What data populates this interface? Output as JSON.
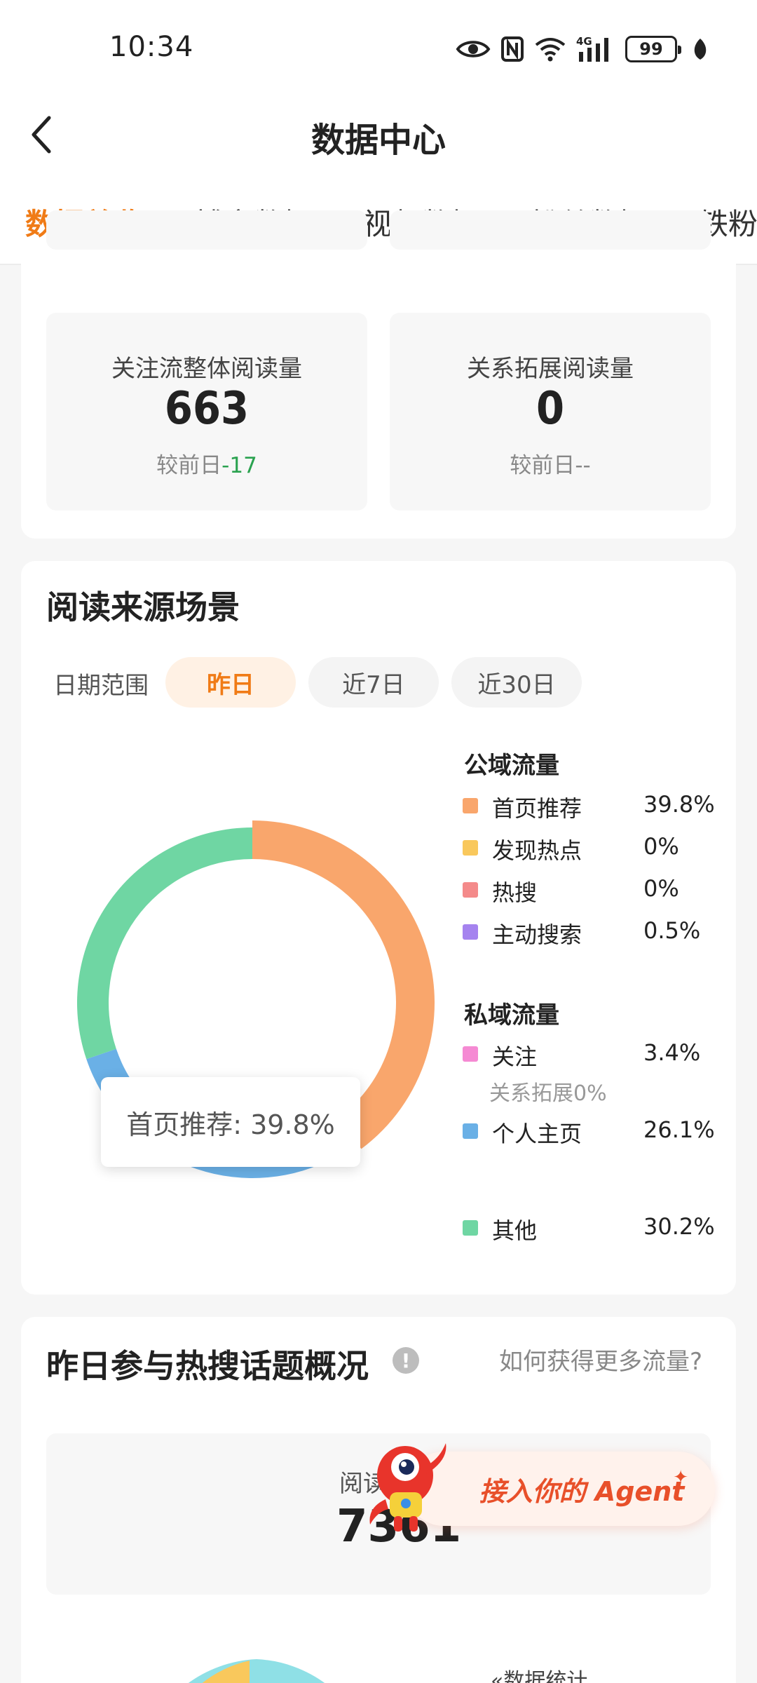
{
  "status_bar": {
    "time": "10:34",
    "battery": "99",
    "icons": [
      "eye-icon",
      "nfc-icon",
      "wifi-icon",
      "signal-4g-icon",
      "battery-icon",
      "leaf-icon"
    ]
  },
  "header": {
    "title": "数据中心"
  },
  "tabs": [
    {
      "label": "数据总览",
      "active": true
    },
    {
      "label": "博文数据",
      "active": false
    },
    {
      "label": "视频数据",
      "active": false
    },
    {
      "label": "粉丝数据",
      "active": false
    },
    {
      "label": "铁粉",
      "active": false
    }
  ],
  "stats": [
    {
      "label": "关注流整体阅读量",
      "value": "663",
      "compare_prefix": "较前日",
      "compare_value": "-17"
    },
    {
      "label": "关系拓展阅读量",
      "value": "0",
      "compare_prefix": "较前日",
      "compare_value": "--"
    }
  ],
  "read_source": {
    "title": "阅读来源场景",
    "date_range_label": "日期范围",
    "date_options": [
      {
        "label": "昨日",
        "active": true
      },
      {
        "label": "近7日",
        "active": false
      },
      {
        "label": "近30日",
        "active": false
      }
    ],
    "tooltip": "首页推荐: 39.8%",
    "groups": {
      "public": "公域流量",
      "private": "私域流量"
    },
    "legend": [
      {
        "name": "首页推荐",
        "percent": "39.8%",
        "color": "#f9a66c",
        "group": "public"
      },
      {
        "name": "发现热点",
        "percent": "0%",
        "color": "#f9c85c",
        "group": "public"
      },
      {
        "name": "热搜",
        "percent": "0%",
        "color": "#f48a8a",
        "group": "public"
      },
      {
        "name": "主动搜索",
        "percent": "0.5%",
        "color": "#a583ef",
        "group": "public"
      },
      {
        "name": "关注",
        "percent": "3.4%",
        "color": "#f58ad3",
        "group": "private",
        "sub": "关系拓展0%"
      },
      {
        "name": "个人主页",
        "percent": "26.1%",
        "color": "#6ab0e6",
        "group": "private"
      },
      {
        "name": "其他",
        "percent": "30.2%",
        "color": "#6fd6a3",
        "group": "other"
      }
    ]
  },
  "chart_data": {
    "type": "pie",
    "categories": [
      "首页推荐",
      "发现热点",
      "热搜",
      "主动搜索",
      "关注",
      "个人主页",
      "其他"
    ],
    "values": [
      39.8,
      0,
      0,
      0.5,
      3.4,
      26.1,
      30.2
    ],
    "colors": [
      "#f9a66c",
      "#f9c85c",
      "#f48a8a",
      "#a583ef",
      "#f58ad3",
      "#6ab0e6",
      "#6fd6a3"
    ],
    "legend_position": "right"
  },
  "hot_topics": {
    "title": "昨日参与热搜话题概况",
    "help_link": "如何获得更多流量?",
    "read_label": "阅读",
    "read_value": "7361",
    "bottom_partial_label": "«数据统计"
  },
  "agent_banner": {
    "text": "接入你的 Agent"
  }
}
